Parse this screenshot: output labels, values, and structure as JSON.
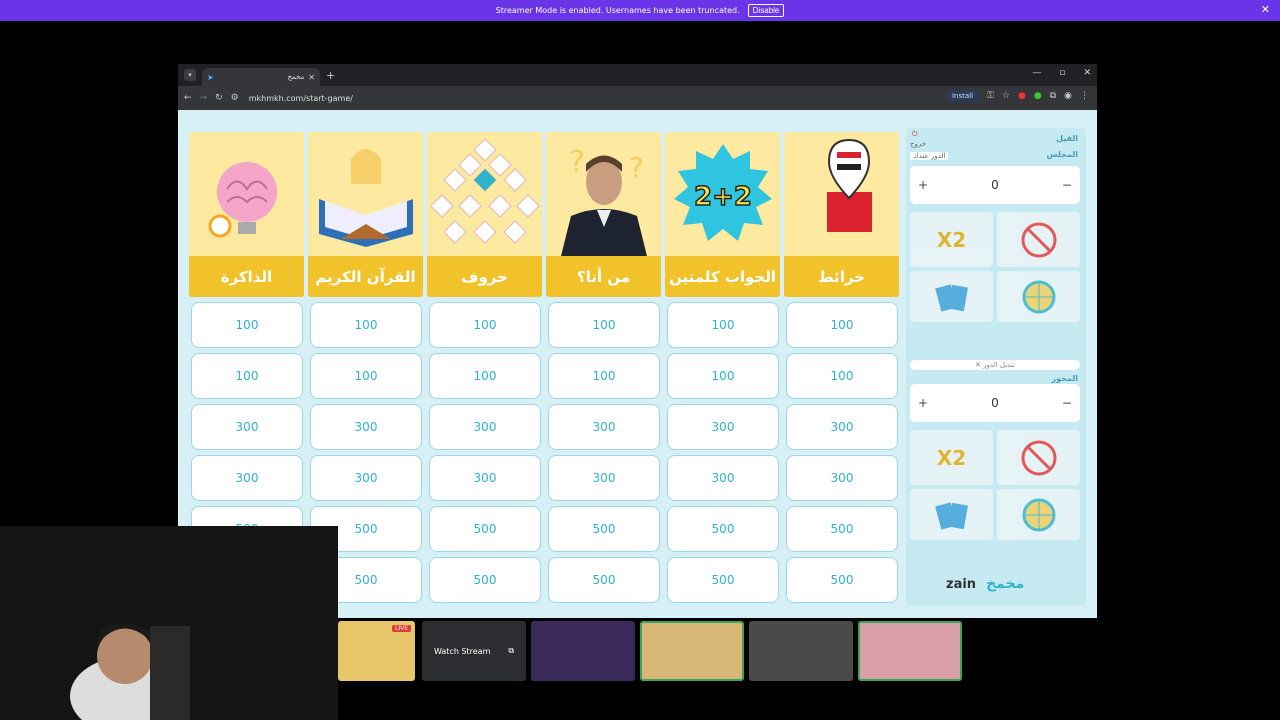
{
  "banner": {
    "text": "Streamer Mode is enabled. Usernames have been truncated.",
    "button": "Disable",
    "close": "✕"
  },
  "browser": {
    "tab_title": "مخمخ",
    "tab_close": "✕",
    "new_tab": "+",
    "url": "mkhmkh.com/start-game/",
    "install_label": "Install",
    "win_min": "—",
    "win_max": "▫",
    "win_close": "✕"
  },
  "categories": [
    {
      "label": "الذاكرة"
    },
    {
      "label": "القرآن الكريم"
    },
    {
      "label": "حروف"
    },
    {
      "label": "من أنا؟"
    },
    {
      "label": "الجواب كلمتين"
    },
    {
      "label": "خرائط"
    }
  ],
  "points": [
    "100",
    "100",
    "300",
    "300",
    "500",
    "500"
  ],
  "side": {
    "exit_label": "خروج",
    "team1": {
      "name": "الفيل",
      "subname": "المجلس",
      "turn_tag": "الدور عندك",
      "score": "0",
      "plus": "+",
      "minus": "−"
    },
    "switch_turn": "✕ تبديل الدور",
    "team2": {
      "name": "المحور",
      "score": "0",
      "plus": "+",
      "minus": "−"
    },
    "powerups": [
      "X2",
      "منع الخصم",
      "اسأل صديق",
      "عجلة الحظ"
    ],
    "sponsor1": "zain",
    "sponsor2": "مخمخ"
  },
  "bottom": {
    "watch_label": "Watch Stream",
    "live": "LIVE"
  },
  "colors": {
    "banner": "#6a35e8",
    "tile": "#fdeaa0",
    "label": "#f2c22a",
    "cell_text": "#2fb3cc",
    "page_bg": "#d6f0f6"
  }
}
